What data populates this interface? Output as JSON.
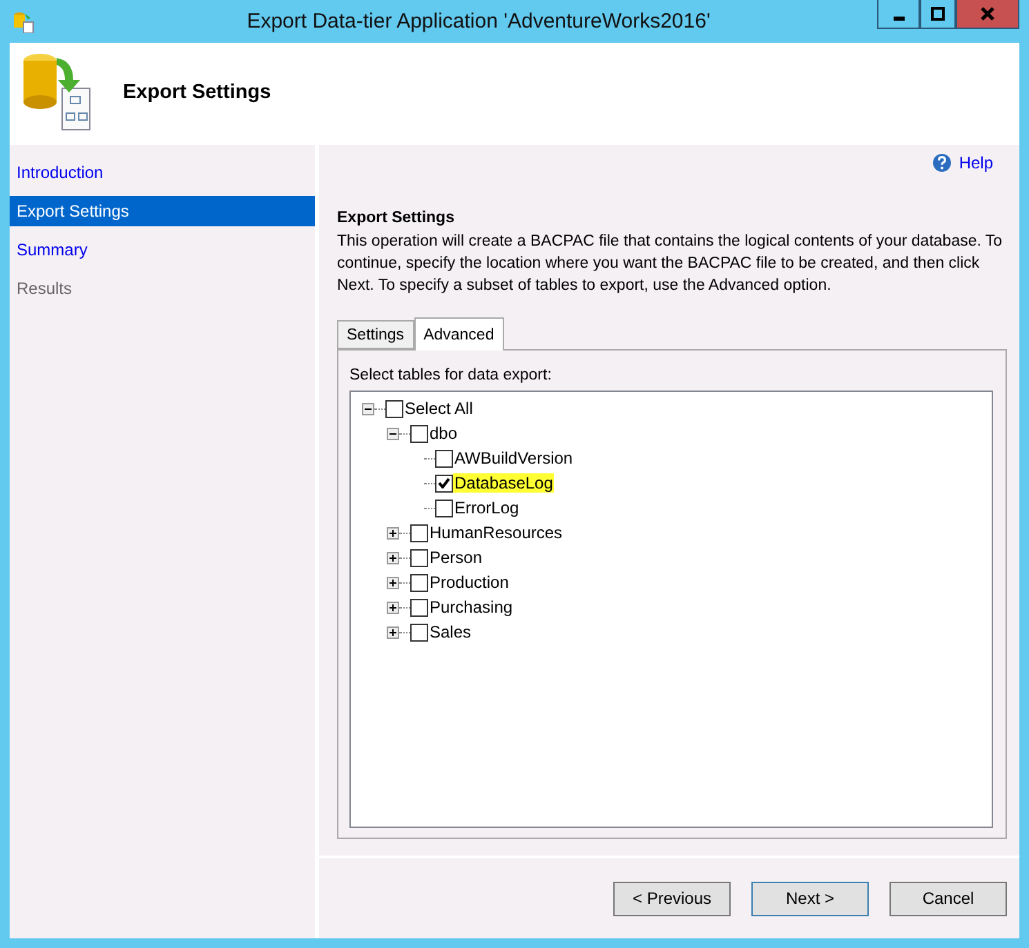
{
  "window": {
    "title": "Export Data-tier Application 'AdventureWorks2016'"
  },
  "header": {
    "title": "Export Settings"
  },
  "sidebar": {
    "items": [
      {
        "label": "Introduction",
        "selected": false,
        "disabled": false
      },
      {
        "label": "Export Settings",
        "selected": true,
        "disabled": false
      },
      {
        "label": "Summary",
        "selected": false,
        "disabled": false
      },
      {
        "label": "Results",
        "selected": false,
        "disabled": true
      }
    ]
  },
  "help": "Help",
  "section": {
    "title": "Export Settings",
    "description": "This operation will create a BACPAC file that contains the logical contents of your database. To continue, specify the location where you want the BACPAC file to be created, and then click Next. To specify a subset of tables to export, use the Advanced option."
  },
  "tabs": [
    {
      "label": "Settings",
      "selected": false
    },
    {
      "label": "Advanced",
      "selected": true
    }
  ],
  "tree_label": "Select tables for data export:",
  "tree": [
    {
      "label": "Select All",
      "checked": false,
      "expanded": true,
      "children": [
        {
          "label": "dbo",
          "checked": false,
          "expanded": true,
          "children": [
            {
              "label": "AWBuildVersion",
              "checked": false,
              "highlighted": false
            },
            {
              "label": "DatabaseLog",
              "checked": true,
              "highlighted": true
            },
            {
              "label": "ErrorLog",
              "checked": false,
              "highlighted": false
            }
          ]
        },
        {
          "label": "HumanResources",
          "checked": false,
          "expanded": false
        },
        {
          "label": "Person",
          "checked": false,
          "expanded": false
        },
        {
          "label": "Production",
          "checked": false,
          "expanded": false
        },
        {
          "label": "Purchasing",
          "checked": false,
          "expanded": false
        },
        {
          "label": "Sales",
          "checked": false,
          "expanded": false
        }
      ]
    }
  ],
  "buttons": [
    {
      "label": "< Previous",
      "selected": false
    },
    {
      "label": "Next >",
      "selected": true
    },
    {
      "label": "Cancel",
      "selected": false
    }
  ]
}
